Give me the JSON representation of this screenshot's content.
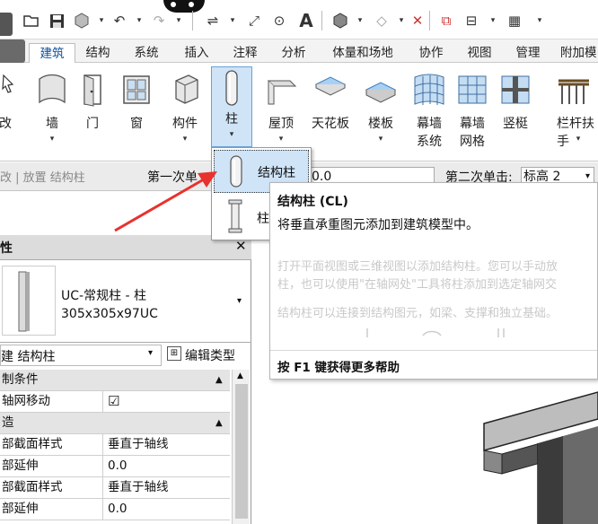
{
  "ribbon_tabs": [
    "建筑",
    "结构",
    "系统",
    "插入",
    "注释",
    "分析",
    "体量和场地",
    "协作",
    "视图",
    "管理",
    "附加模"
  ],
  "ribbon_buttons": [
    {
      "label": "改",
      "arrow": ""
    },
    {
      "label": "墙",
      "arrow": "▾"
    },
    {
      "label": "门",
      "arrow": ""
    },
    {
      "label": "窗",
      "arrow": ""
    },
    {
      "label": "构件",
      "arrow": "▾"
    },
    {
      "label": "柱",
      "arrow": "▾"
    },
    {
      "label": "屋顶",
      "arrow": "▾"
    },
    {
      "label": "天花板",
      "arrow": ""
    },
    {
      "label": "楼板",
      "arrow": "▾"
    },
    {
      "label": "幕墙\n系统",
      "arrow": ""
    },
    {
      "label": "幕墙\n网格",
      "arrow": ""
    },
    {
      "label": "竖梃",
      "arrow": ""
    },
    {
      "label": "栏杆扶手",
      "arrow": "▾"
    }
  ],
  "options_bar": {
    "context": "改 | 放置 结构柱",
    "first_click_label": "第一次单",
    "first_click_value": "0.0",
    "second_click_label": "第二次单击:",
    "second_click_value": "标高 2"
  },
  "column_dropdown": {
    "items": [
      "结构柱",
      "柱"
    ]
  },
  "tooltip": {
    "title": "结构柱 (CL)",
    "description": "将垂直承重图元添加到建筑模型中。",
    "detail1a": "打开平面视图或三维视图以添加结构柱。您可以手动放",
    "detail1b": "柱，也可以使用\"在轴网处\"工具将柱添加到选定轴网交",
    "detail2": "结构柱可以连接到结构图元，如梁、支撑和独立基础。",
    "help": "按 F1 键获得更多帮助"
  },
  "properties": {
    "header": "性",
    "type_name_line1": "UC-常规柱 - 柱",
    "type_name_line2": "305x305x97UC",
    "category_selector": "建 结构柱",
    "edit_type_label": "编辑类型",
    "rows": [
      {
        "kind": "group",
        "name": "制条件",
        "value": "",
        "tog": "▲"
      },
      {
        "kind": "row",
        "name": "轴网移动",
        "value": "☑",
        "tog": ""
      },
      {
        "kind": "group",
        "name": "造",
        "value": "",
        "tog": "▲"
      },
      {
        "kind": "row",
        "name": "部截面样式",
        "value": "垂直于轴线",
        "tog": ""
      },
      {
        "kind": "row",
        "name": "部延伸",
        "value": "0.0",
        "tog": ""
      },
      {
        "kind": "row",
        "name": "部截面样式",
        "value": "垂直于轴线",
        "tog": ""
      },
      {
        "kind": "row",
        "name": "部延伸",
        "value": "0.0",
        "tog": ""
      }
    ]
  },
  "colors": {
    "accent": "#0b4f9e",
    "arrow": "#e8322e",
    "selected_bg": "#cfe4f7"
  }
}
